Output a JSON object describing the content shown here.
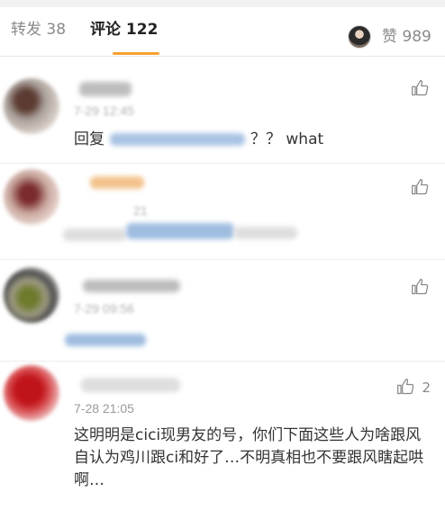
{
  "tabs": {
    "reposts_label": "转发 38",
    "comments_label": "评论 122"
  },
  "likes": {
    "label": "赞 989"
  },
  "colors": {
    "accent_underline": "#f7a02e",
    "text_primary": "#333333",
    "text_secondary": "#9a9a9a"
  },
  "comments": [
    {
      "timestamp": "7-29 12:45",
      "text_prefix": "回复",
      "text_suffix": "？？ what",
      "like_icon": "thumbs-up-icon"
    },
    {
      "timestamp": "21",
      "like_icon": "thumbs-up-icon"
    },
    {
      "timestamp": "7-29 09:56",
      "like_icon": "thumbs-up-icon"
    },
    {
      "timestamp": "7-28 21:05",
      "text": "这明明是cici现男友的号，你们下面这些人为啥跟风自认为鸡川跟ci和好了…不明真相也不要跟风瞎起哄啊…",
      "like_icon": "thumbs-up-icon",
      "like_count": "2"
    }
  ]
}
